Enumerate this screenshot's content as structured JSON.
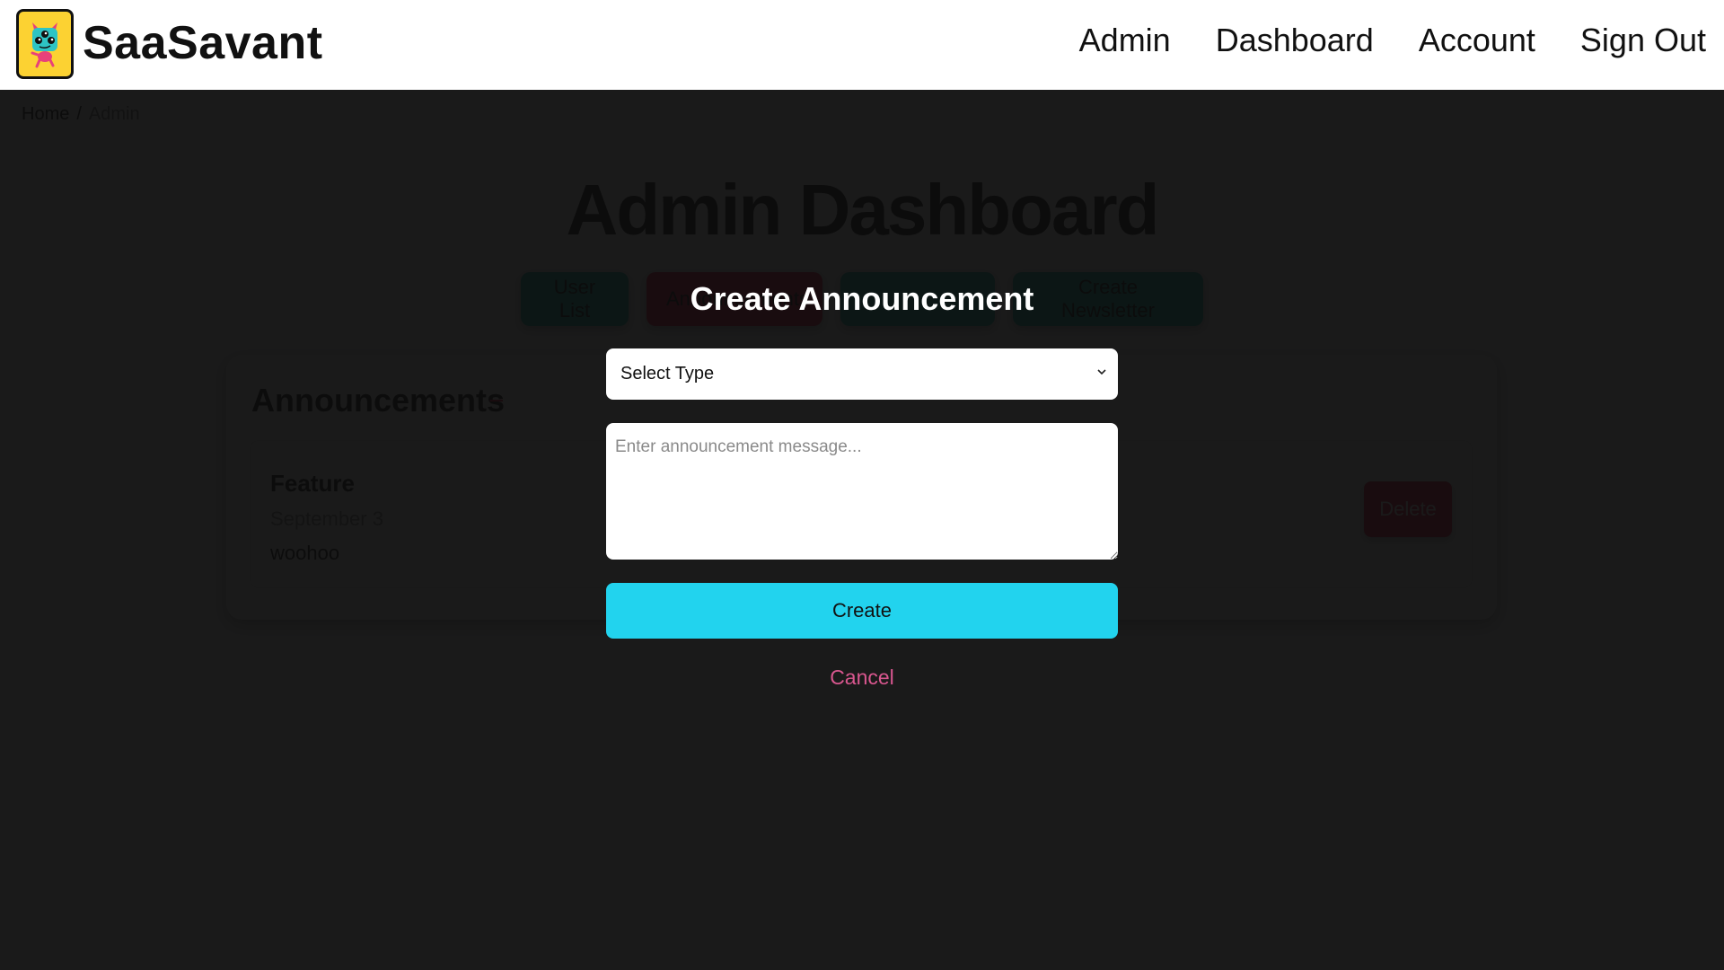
{
  "header": {
    "brand": "SaaSavant",
    "logo_icon": "monster-logo-icon",
    "nav": [
      {
        "label": "Admin"
      },
      {
        "label": "Dashboard"
      },
      {
        "label": "Account"
      },
      {
        "label": "Sign Out"
      }
    ]
  },
  "breadcrumb": {
    "items": [
      "Home",
      "Admin"
    ],
    "separator": "/"
  },
  "page": {
    "title": "Admin Dashboard",
    "tabs": [
      {
        "label": "User List",
        "color": "#14b8a6"
      },
      {
        "label": "Announcements",
        "color": "#e11d48"
      },
      {
        "label": "",
        "color": "#14b8a6"
      },
      {
        "label": "Create Newsletter",
        "color": "#14b8a6"
      }
    ]
  },
  "announcements": {
    "title": "Announcements",
    "collapse_symbol": "−",
    "items": [
      {
        "type": "Feature",
        "date": "September 3",
        "message": "woohoo",
        "delete_label": "Delete"
      }
    ]
  },
  "modal": {
    "title": "Create Announcement",
    "select": {
      "selected": "Select Type",
      "icon": "chevron-down-icon"
    },
    "message": {
      "value": "",
      "placeholder": "Enter announcement message..."
    },
    "create_label": "Create",
    "cancel_label": "Cancel",
    "colors": {
      "create_bg": "#22d3ee",
      "cancel_text": "#d9578f"
    }
  }
}
